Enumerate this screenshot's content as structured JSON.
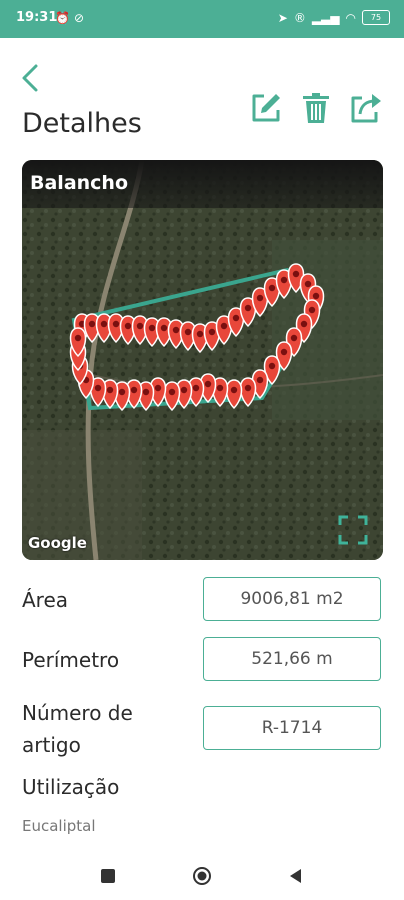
{
  "status_bar": {
    "time": "19:31",
    "battery": "75",
    "left_icons": [
      "alarm-icon",
      "do-not-disturb-icon"
    ],
    "right_icons": [
      "location-icon",
      "registered-icon",
      "signal-icon",
      "wifi-icon",
      "battery-icon"
    ]
  },
  "header": {
    "title": "Detalhes",
    "actions": [
      "edit-icon",
      "trash-icon",
      "share-icon"
    ]
  },
  "map": {
    "label": "Balancho",
    "attribution": "Google"
  },
  "fields": {
    "area": {
      "label": "Área",
      "value": "9006,81 m2"
    },
    "perimeter": {
      "label": "Perímetro",
      "value": "521,66 m"
    },
    "article": {
      "label_line1": "Número de",
      "label_line2": "artigo",
      "value": "R-1714"
    }
  },
  "usage": {
    "label": "Utilização",
    "value": "Eucaliptal"
  },
  "colors": {
    "accent": "#4caf95",
    "marker": "#e8473a",
    "text": "#2b2b2b"
  },
  "nav_bar": [
    "recents-square-icon",
    "home-circle-icon",
    "back-triangle-icon"
  ]
}
